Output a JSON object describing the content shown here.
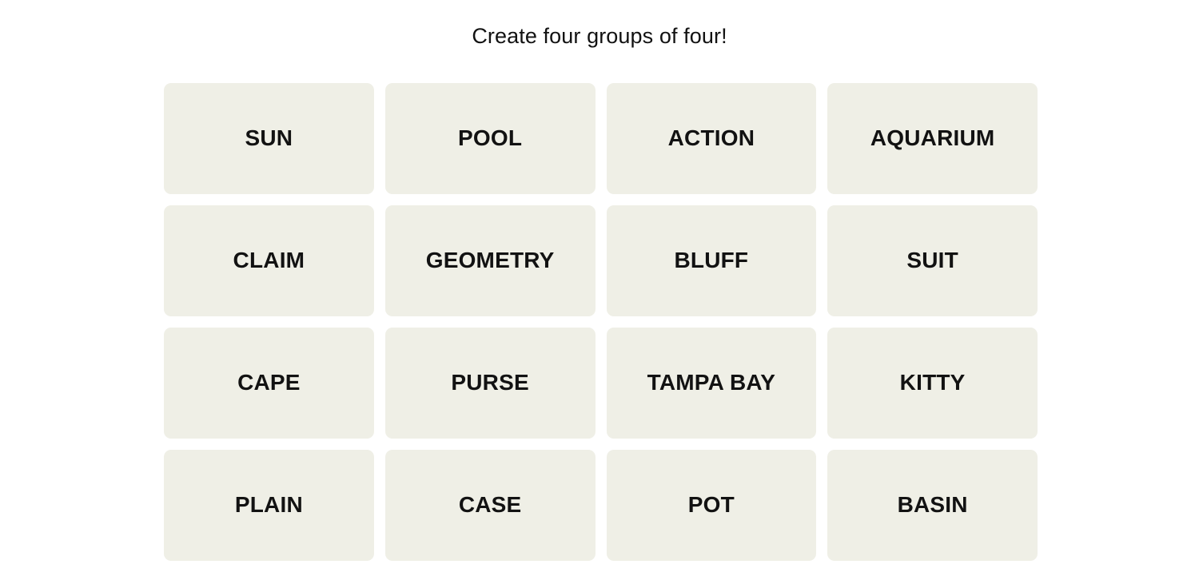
{
  "game": {
    "title": "Create four groups of four!",
    "board": {
      "rows": 4,
      "columns": 4,
      "tile_background_color": "#EFEFE6",
      "tile_text_color": "#121212",
      "page_background_color": "#FFFFFF",
      "tiles": [
        {
          "label": "SUN"
        },
        {
          "label": "POOL"
        },
        {
          "label": "ACTION"
        },
        {
          "label": "AQUARIUM"
        },
        {
          "label": "CLAIM"
        },
        {
          "label": "GEOMETRY"
        },
        {
          "label": "BLUFF"
        },
        {
          "label": "SUIT"
        },
        {
          "label": "CAPE"
        },
        {
          "label": "PURSE"
        },
        {
          "label": "TAMPA BAY"
        },
        {
          "label": "KITTY"
        },
        {
          "label": "PLAIN"
        },
        {
          "label": "CASE"
        },
        {
          "label": "POT"
        },
        {
          "label": "BASIN"
        }
      ]
    }
  }
}
